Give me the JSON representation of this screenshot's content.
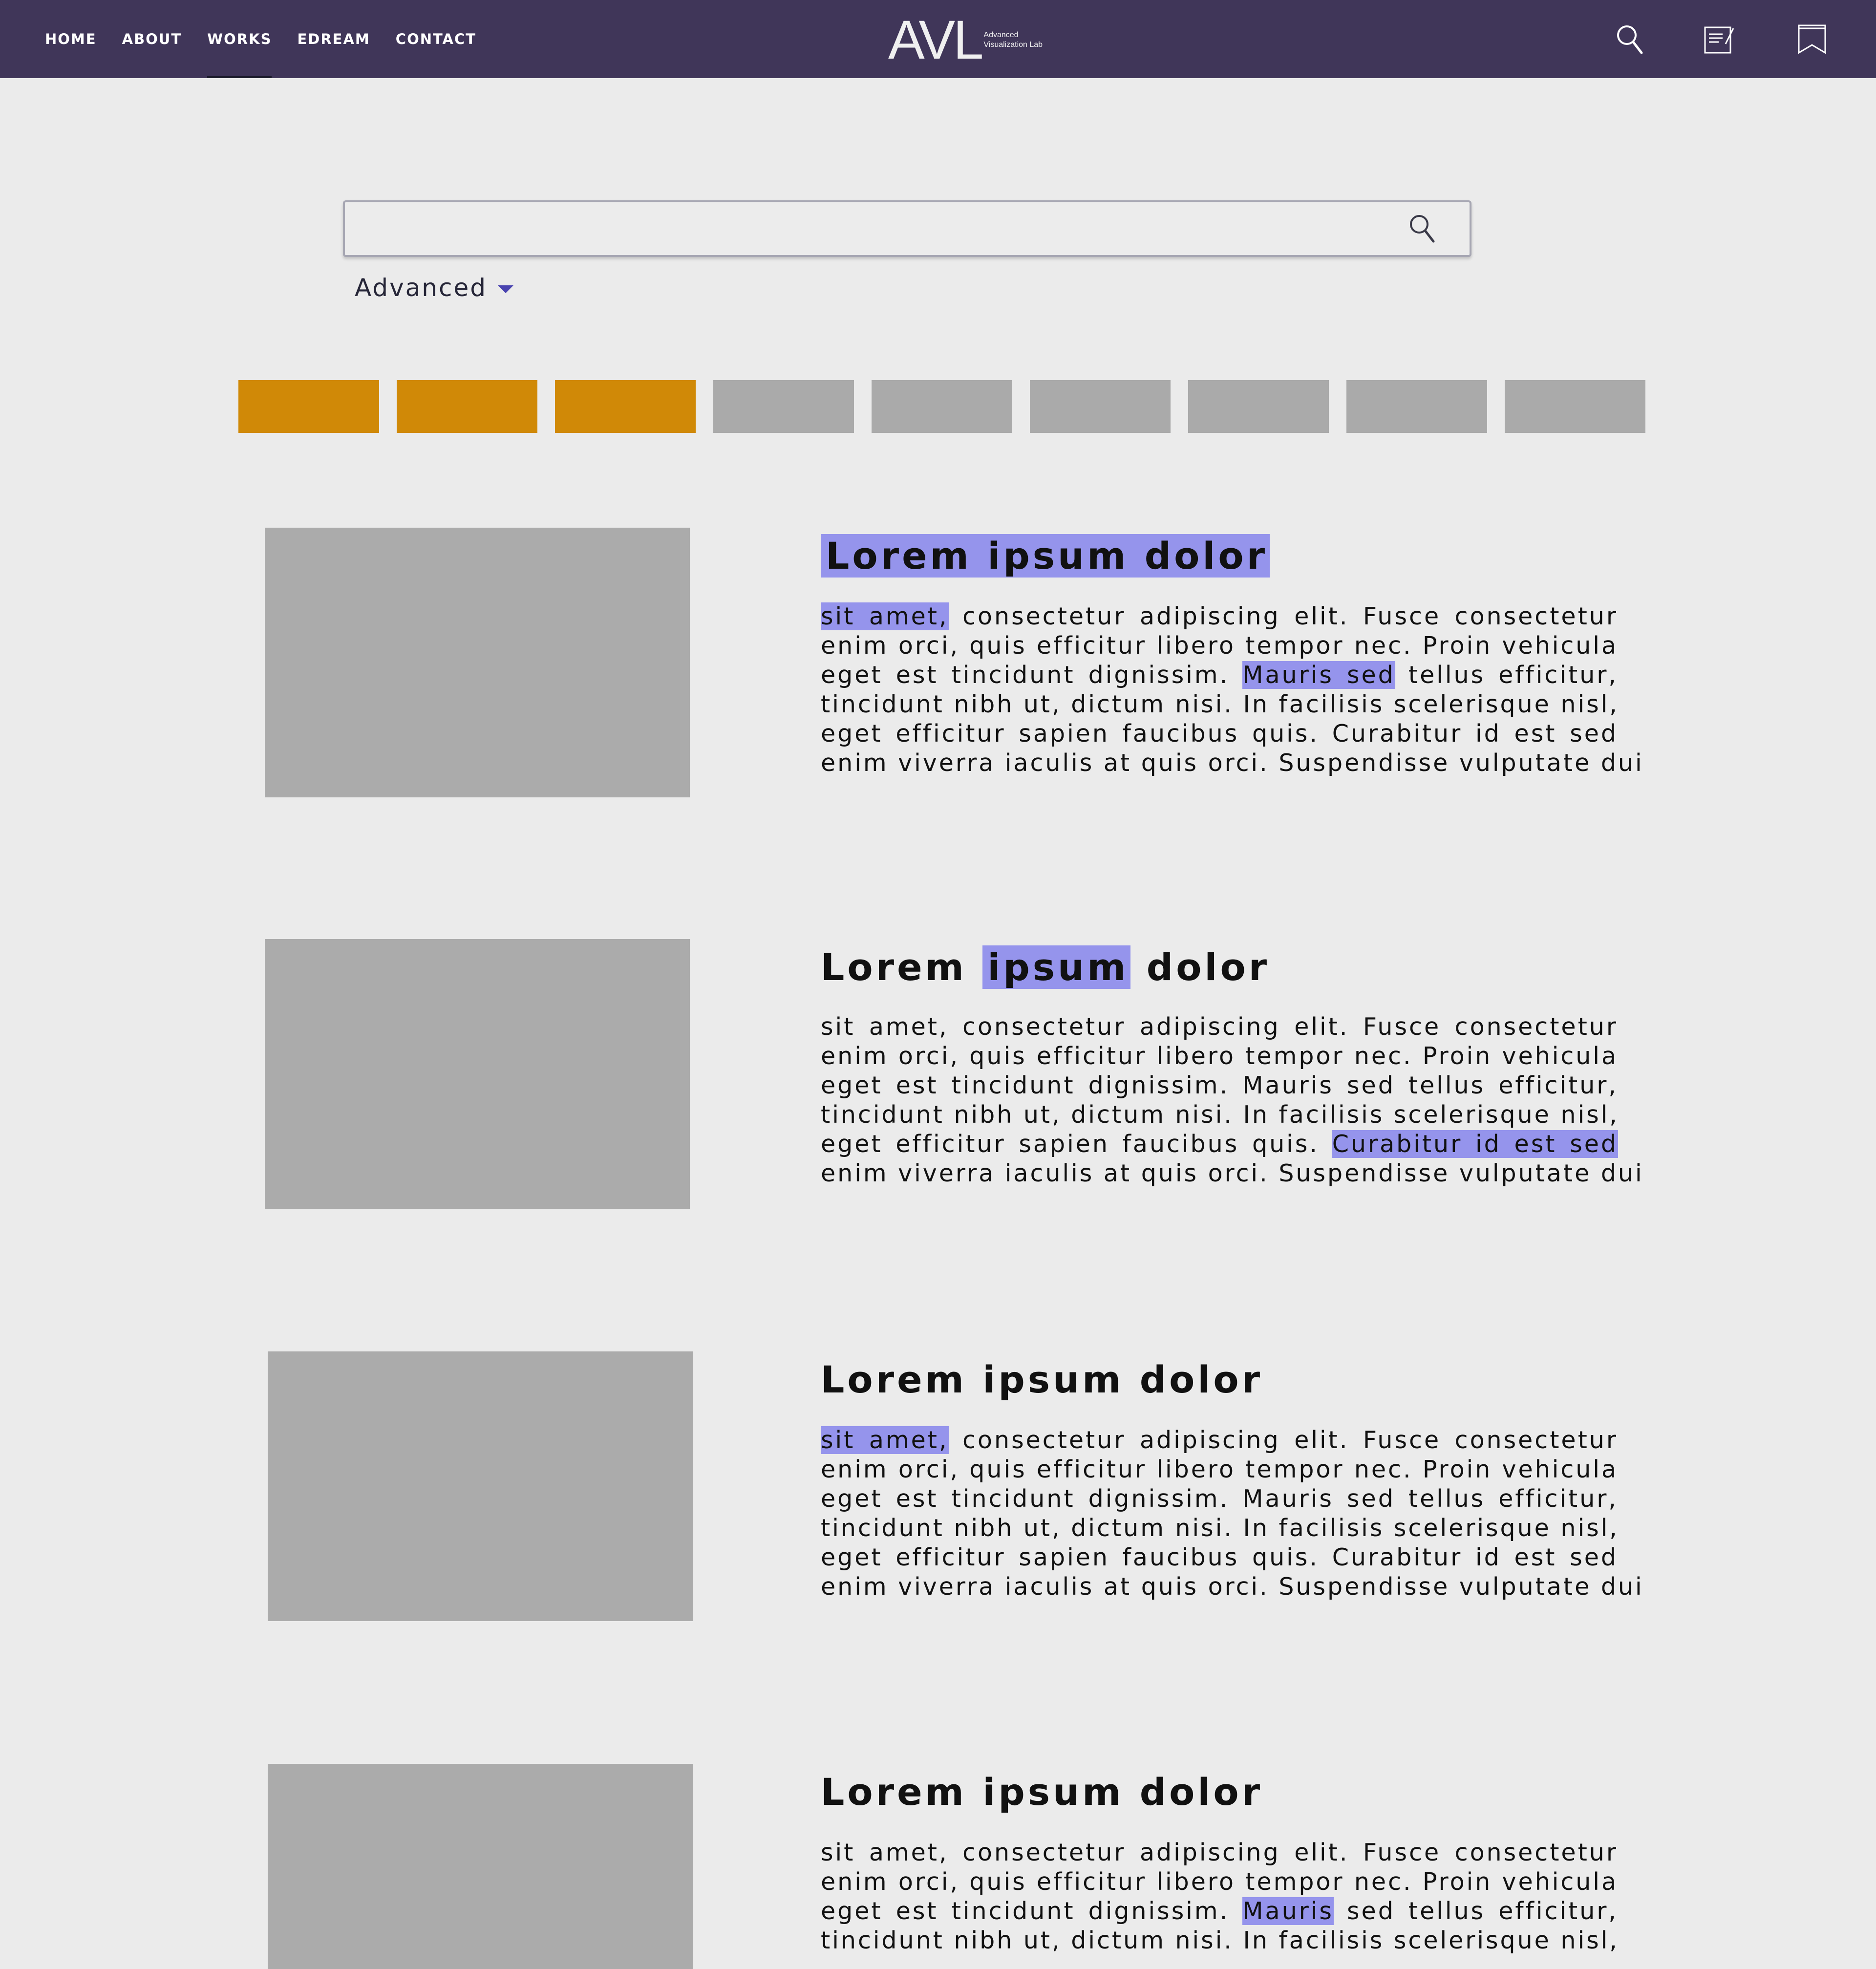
{
  "nav": {
    "items": [
      {
        "label": "HOME"
      },
      {
        "label": "ABOUT"
      },
      {
        "label": "WORKS"
      },
      {
        "label": "EDREAM"
      },
      {
        "label": "CONTACT"
      }
    ],
    "active": "WORKS"
  },
  "logo": {
    "mark": "AVL",
    "sub_line1": "Advanced",
    "sub_line2": "Visualization Lab"
  },
  "header_icons": [
    "search-icon",
    "notes-icon",
    "bookmark-icon"
  ],
  "search": {
    "value": "",
    "placeholder": "",
    "advanced_label": "Advanced"
  },
  "filters": {
    "chips": [
      {
        "state": "selected",
        "color": "#d08907"
      },
      {
        "state": "selected",
        "color": "#d08907"
      },
      {
        "state": "selected",
        "color": "#d08907"
      },
      {
        "state": "unselected",
        "color": "#aaaaaa"
      },
      {
        "state": "unselected",
        "color": "#aaaaaa"
      },
      {
        "state": "unselected",
        "color": "#aaaaaa"
      },
      {
        "state": "unselected",
        "color": "#aaaaaa"
      },
      {
        "state": "unselected",
        "color": "#aaaaaa"
      },
      {
        "state": "unselected",
        "color": "#aaaaaa"
      }
    ]
  },
  "colors": {
    "header_bg": "#403659",
    "highlight": "#9594ec",
    "page_bg": "#ebebeb",
    "thumb": "#ababab"
  },
  "results": [
    {
      "title": [
        {
          "text": "Lorem ipsum dolor",
          "hl": true
        }
      ],
      "lines": [
        [
          {
            "text": "sit amet,",
            "hl": true
          },
          {
            "text": " consectetur adipiscing elit. Fusce consectetur",
            "hl": false
          }
        ],
        [
          {
            "text": "enim orci, quis efficitur libero tempor nec. Proin vehicula",
            "hl": false
          }
        ],
        [
          {
            "text": "eget est tincidunt dignissim. ",
            "hl": false
          },
          {
            "text": "Mauris sed",
            "hl": true
          },
          {
            "text": " tellus efficitur,",
            "hl": false
          }
        ],
        [
          {
            "text": "tincidunt nibh ut, dictum nisi. In facilisis scelerisque nisl,",
            "hl": false
          }
        ],
        [
          {
            "text": "eget efficitur sapien faucibus quis. Curabitur id est sed",
            "hl": false
          }
        ],
        [
          {
            "text": "enim viverra iaculis at quis orci. Suspendisse vulputate dui",
            "hl": false
          }
        ]
      ]
    },
    {
      "title": [
        {
          "text": "Lorem ",
          "hl": false
        },
        {
          "text": "ipsum",
          "hl": true
        },
        {
          "text": " dolor",
          "hl": false
        }
      ],
      "lines": [
        [
          {
            "text": "sit amet, consectetur adipiscing elit. Fusce consectetur",
            "hl": false
          }
        ],
        [
          {
            "text": "enim orci, quis efficitur libero tempor nec. Proin vehicula",
            "hl": false
          }
        ],
        [
          {
            "text": "eget est tincidunt dignissim. Mauris sed tellus efficitur,",
            "hl": false
          }
        ],
        [
          {
            "text": "tincidunt nibh ut, dictum nisi. In facilisis scelerisque nisl,",
            "hl": false
          }
        ],
        [
          {
            "text": "eget efficitur sapien faucibus quis. ",
            "hl": false
          },
          {
            "text": "Curabitur id est sed",
            "hl": true
          }
        ],
        [
          {
            "text": "enim viverra iaculis at quis orci. Suspendisse vulputate dui",
            "hl": false
          }
        ]
      ]
    },
    {
      "title": [
        {
          "text": "Lorem ipsum dolor",
          "hl": false
        }
      ],
      "lines": [
        [
          {
            "text": "sit amet,",
            "hl": true
          },
          {
            "text": " consectetur adipiscing elit. Fusce consectetur",
            "hl": false
          }
        ],
        [
          {
            "text": "enim orci, quis efficitur libero tempor nec. Proin vehicula",
            "hl": false
          }
        ],
        [
          {
            "text": "eget est tincidunt dignissim. Mauris sed tellus efficitur,",
            "hl": false
          }
        ],
        [
          {
            "text": "tincidunt nibh ut, dictum nisi. In facilisis scelerisque nisl,",
            "hl": false
          }
        ],
        [
          {
            "text": "eget efficitur sapien faucibus quis. Curabitur id est sed",
            "hl": false
          }
        ],
        [
          {
            "text": "enim viverra iaculis at quis orci. Suspendisse vulputate dui",
            "hl": false
          }
        ]
      ]
    },
    {
      "title": [
        {
          "text": "Lorem ipsum dolor",
          "hl": false
        }
      ],
      "lines": [
        [
          {
            "text": "sit amet, consectetur adipiscing elit. Fusce consectetur",
            "hl": false
          }
        ],
        [
          {
            "text": "enim orci, quis efficitur libero tempor nec. Proin vehicula",
            "hl": false
          }
        ],
        [
          {
            "text": "eget est tincidunt dignissim. ",
            "hl": false
          },
          {
            "text": "Mauris",
            "hl": true
          },
          {
            "text": " sed tellus efficitur,",
            "hl": false
          }
        ],
        [
          {
            "text": "tincidunt nibh ut, dictum nisi. In facilisis scelerisque nisl,",
            "hl": false
          }
        ]
      ]
    }
  ]
}
